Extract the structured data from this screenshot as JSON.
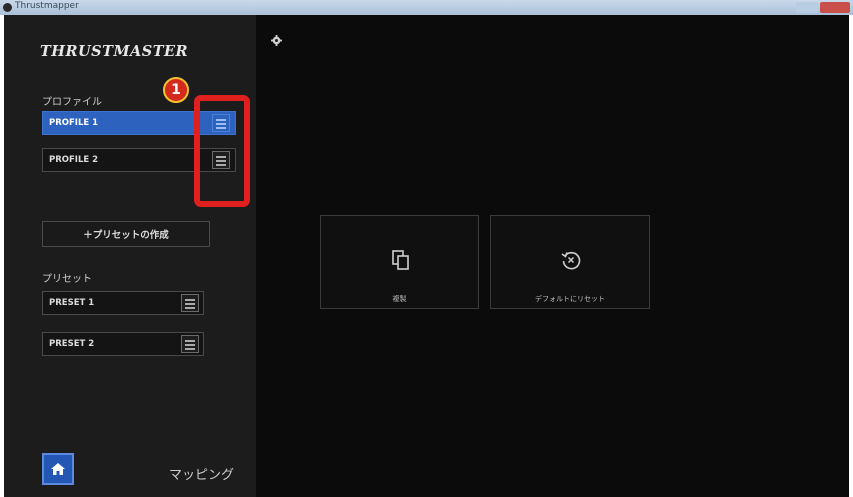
{
  "window": {
    "title": "Thrustmapper"
  },
  "sidebar": {
    "logo": "THRUSTMASTER",
    "profiles_label": "プロファイル",
    "profiles": [
      {
        "label": "PROFILE 1",
        "selected": true
      },
      {
        "label": "PROFILE 2",
        "selected": false
      }
    ],
    "create_preset_label": "＋プリセットの作成",
    "presets_label": "プリセット",
    "presets": [
      {
        "label": "PRESET 1"
      },
      {
        "label": "PRESET 2"
      }
    ],
    "mapping_label": "マッピング"
  },
  "main": {
    "actions": [
      {
        "label": "複製",
        "icon": "copy-icon"
      },
      {
        "label": "デフォルトにリセット",
        "icon": "reset-icon"
      }
    ]
  },
  "annotation": {
    "number": "1"
  },
  "colors": {
    "accent": "#2d63bf",
    "background": "#0b0b0b",
    "sidebar": "#1c1c1c",
    "callout": "#e0201f"
  }
}
